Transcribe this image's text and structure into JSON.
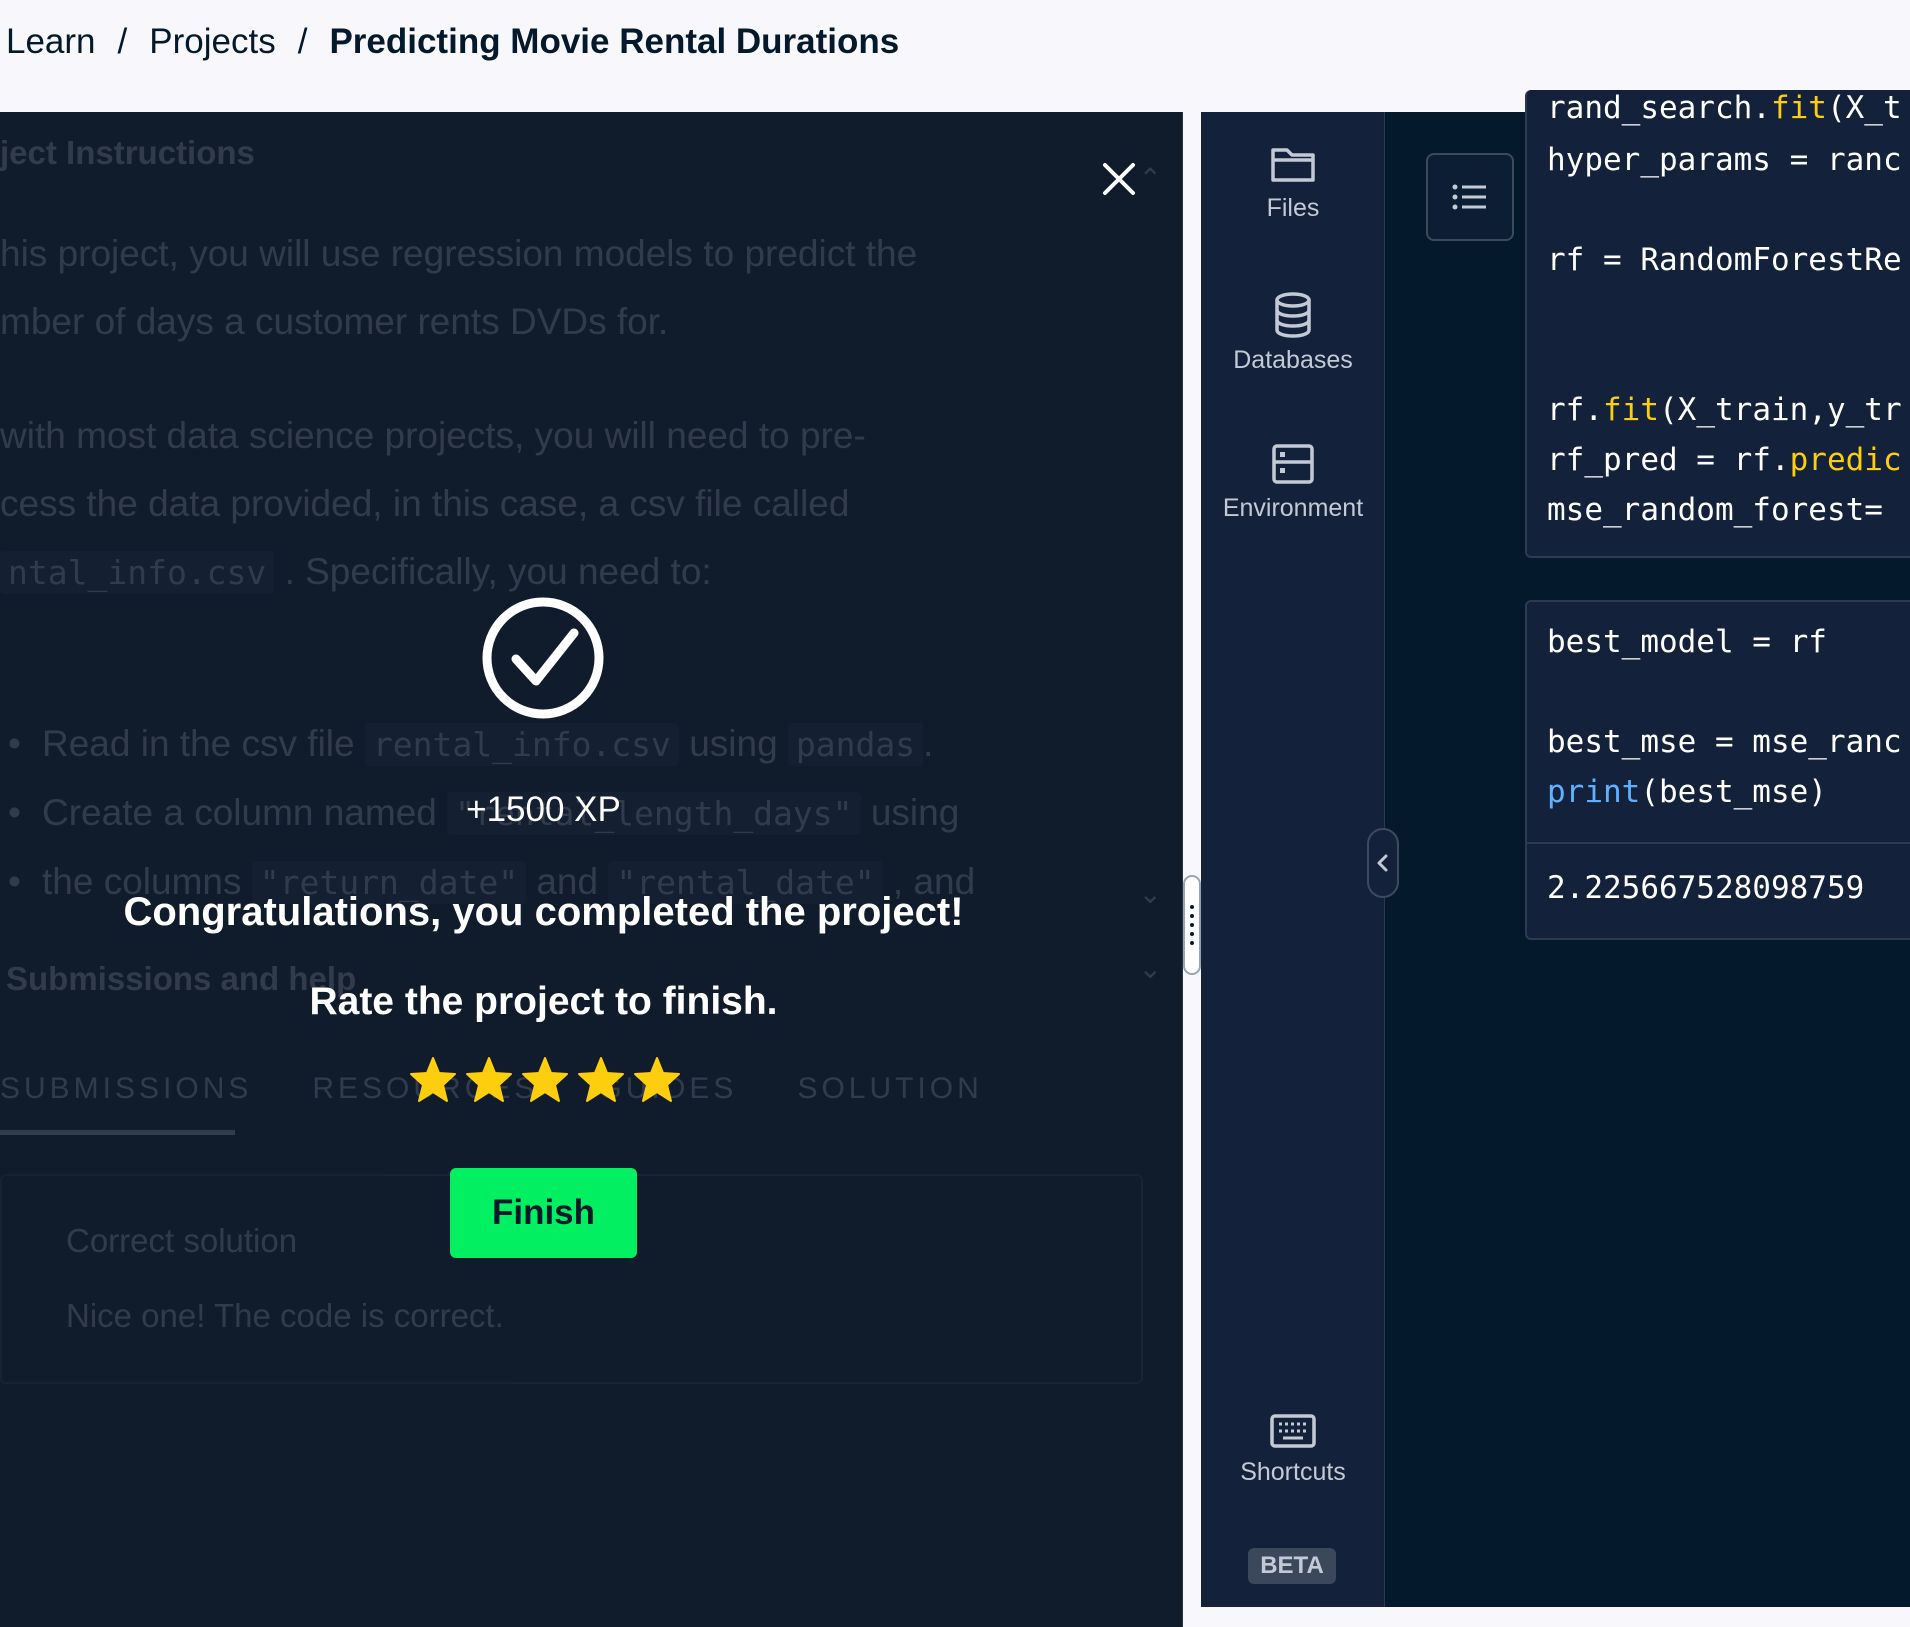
{
  "breadcrumb": {
    "items": [
      "Learn",
      "Projects"
    ],
    "separator": "/",
    "current": "Predicting Movie Rental Durations"
  },
  "instructions": {
    "title": "ject Instructions",
    "para1_line1": "his project, you will use regression models to predict the",
    "para1_line2": "mber of days a customer rents DVDs for.",
    "para2_line1": "with most data science projects, you will need to pre-",
    "para2_line2": "cess the data provided, in this case, a csv file called",
    "para2_line3_code": "ntal_info.csv",
    "para2_line3_text": ". Specifically, you need to:",
    "bullet1_text": "Read in the csv file",
    "bullet1_code1": "rental_info.csv",
    "bullet1_mid": "using",
    "bullet1_code2": "pandas",
    "bullet1_end": ".",
    "bullet2_text": "Create a column named",
    "bullet2_code": "\"rental_length_days\"",
    "bullet2_end": "using",
    "bullet3_text": "the columns",
    "bullet3_code1": "\"return_date\"",
    "bullet3_mid": "and",
    "bullet3_code2": "\"rental_date\"",
    "bullet3_end": ", and"
  },
  "submissions": {
    "title": "Submissions and help",
    "tabs": [
      "SUBMISSIONS",
      "RESOURCES",
      "GUIDES",
      "SOLUTION"
    ],
    "result_title": "Correct solution",
    "result_text": "Nice one! The code is correct."
  },
  "modal": {
    "xp": "+1500 XP",
    "congrats": "Congratulations, you completed the project!",
    "rate_prompt": "Rate the project to finish.",
    "rating": 5,
    "rating_max": 5,
    "finish_label": "Finish",
    "accent_color": "#03ef62",
    "star_color": "#fcce0d"
  },
  "sidebar": {
    "items": [
      {
        "label": "Files",
        "icon": "folder-icon"
      },
      {
        "label": "Databases",
        "icon": "database-icon"
      },
      {
        "label": "Environment",
        "icon": "environment-icon"
      }
    ],
    "shortcuts": {
      "label": "Shortcuts",
      "icon": "keyboard-icon"
    },
    "beta": "BETA"
  },
  "editor": {
    "cell1": {
      "line0_a": "rand_search.",
      "line0_b": "fit",
      "line0_c": "(X_t",
      "line1": "hyper_params = ranc",
      "line2": "rf = RandomForestRe",
      "line3_a": "rf.",
      "line3_b": "fit",
      "line3_c": "(X_train,y_tr",
      "line4_a": "rf_pred = rf.",
      "line4_b": "predic",
      "line5": "mse_random_forest="
    },
    "cell2": {
      "line1": "best_model = rf",
      "line2": "best_mse = mse_ranc",
      "line3_a": "print",
      "line3_b": "(best_mse)",
      "output": "2.225667528098759"
    }
  }
}
